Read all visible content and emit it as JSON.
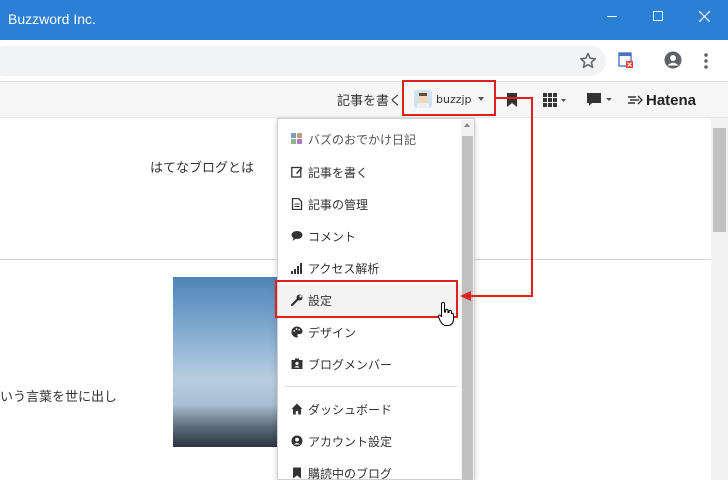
{
  "window": {
    "title": "Buzzword Inc."
  },
  "hatena_header": {
    "write_label": "記事を書く",
    "username": "buzzjp",
    "logo_text": "Hatena"
  },
  "page": {
    "about_link": "はてなブログとは",
    "body_text": "いう言葉を世に出し"
  },
  "dropdown": {
    "blog_name": "バズのおでかけ日記",
    "items": [
      {
        "label": "記事を書く",
        "icon": "edit-icon"
      },
      {
        "label": "記事の管理",
        "icon": "document-icon"
      },
      {
        "label": "コメント",
        "icon": "comment-icon"
      },
      {
        "label": "アクセス解析",
        "icon": "signal-icon"
      },
      {
        "label": "設定",
        "icon": "wrench-icon"
      },
      {
        "label": "デザイン",
        "icon": "palette-icon"
      },
      {
        "label": "ブログメンバー",
        "icon": "members-icon"
      }
    ],
    "account_items": [
      {
        "label": "ダッシュボード",
        "icon": "home-icon"
      },
      {
        "label": "アカウント設定",
        "icon": "user-circle-icon"
      },
      {
        "label": "購読中のブログ",
        "icon": "bookmark-icon"
      }
    ]
  },
  "colors": {
    "titlebar": "#2b7fd4",
    "highlight": "#e0201f"
  }
}
